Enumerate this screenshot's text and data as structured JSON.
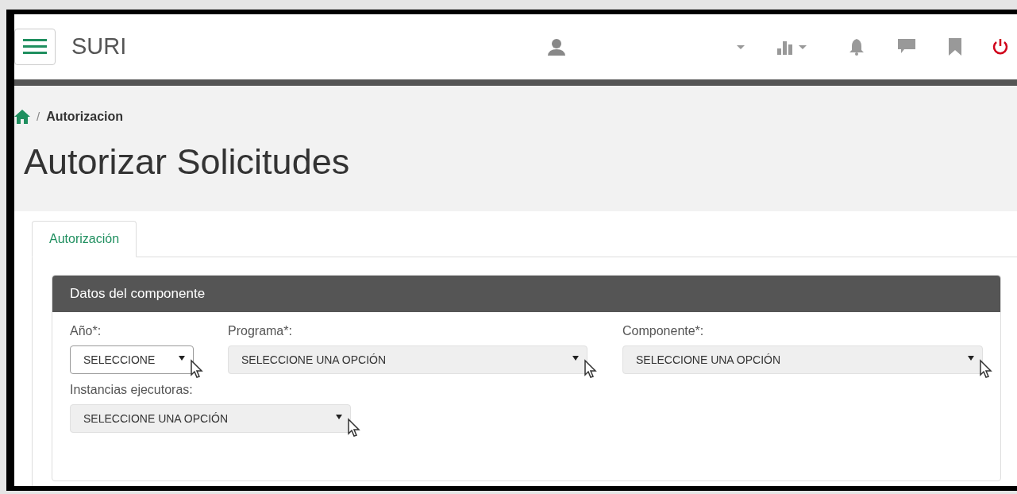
{
  "navbar": {
    "brand": "SURI"
  },
  "breadcrumb": {
    "separator": "/",
    "current": "Autorizacion"
  },
  "page_title": "Autorizar Solicitudes",
  "tabs": [
    {
      "label": "Autorización",
      "selected": true
    }
  ],
  "panel": {
    "title": "Datos del componente",
    "rows": [
      [
        {
          "label": "Año*:",
          "value": "SELECCIONE",
          "disabled": false
        },
        {
          "label": "Programa*:",
          "value": "SELECCIONE UNA OPCIÓN",
          "disabled": true
        },
        {
          "label": "Componente*:",
          "value": "SELECCIONE UNA OPCIÓN",
          "disabled": true
        }
      ],
      [
        {
          "label": "Instancias ejecutoras:",
          "value": "SELECCIONE UNA OPCIÓN",
          "disabled": true
        }
      ]
    ]
  }
}
